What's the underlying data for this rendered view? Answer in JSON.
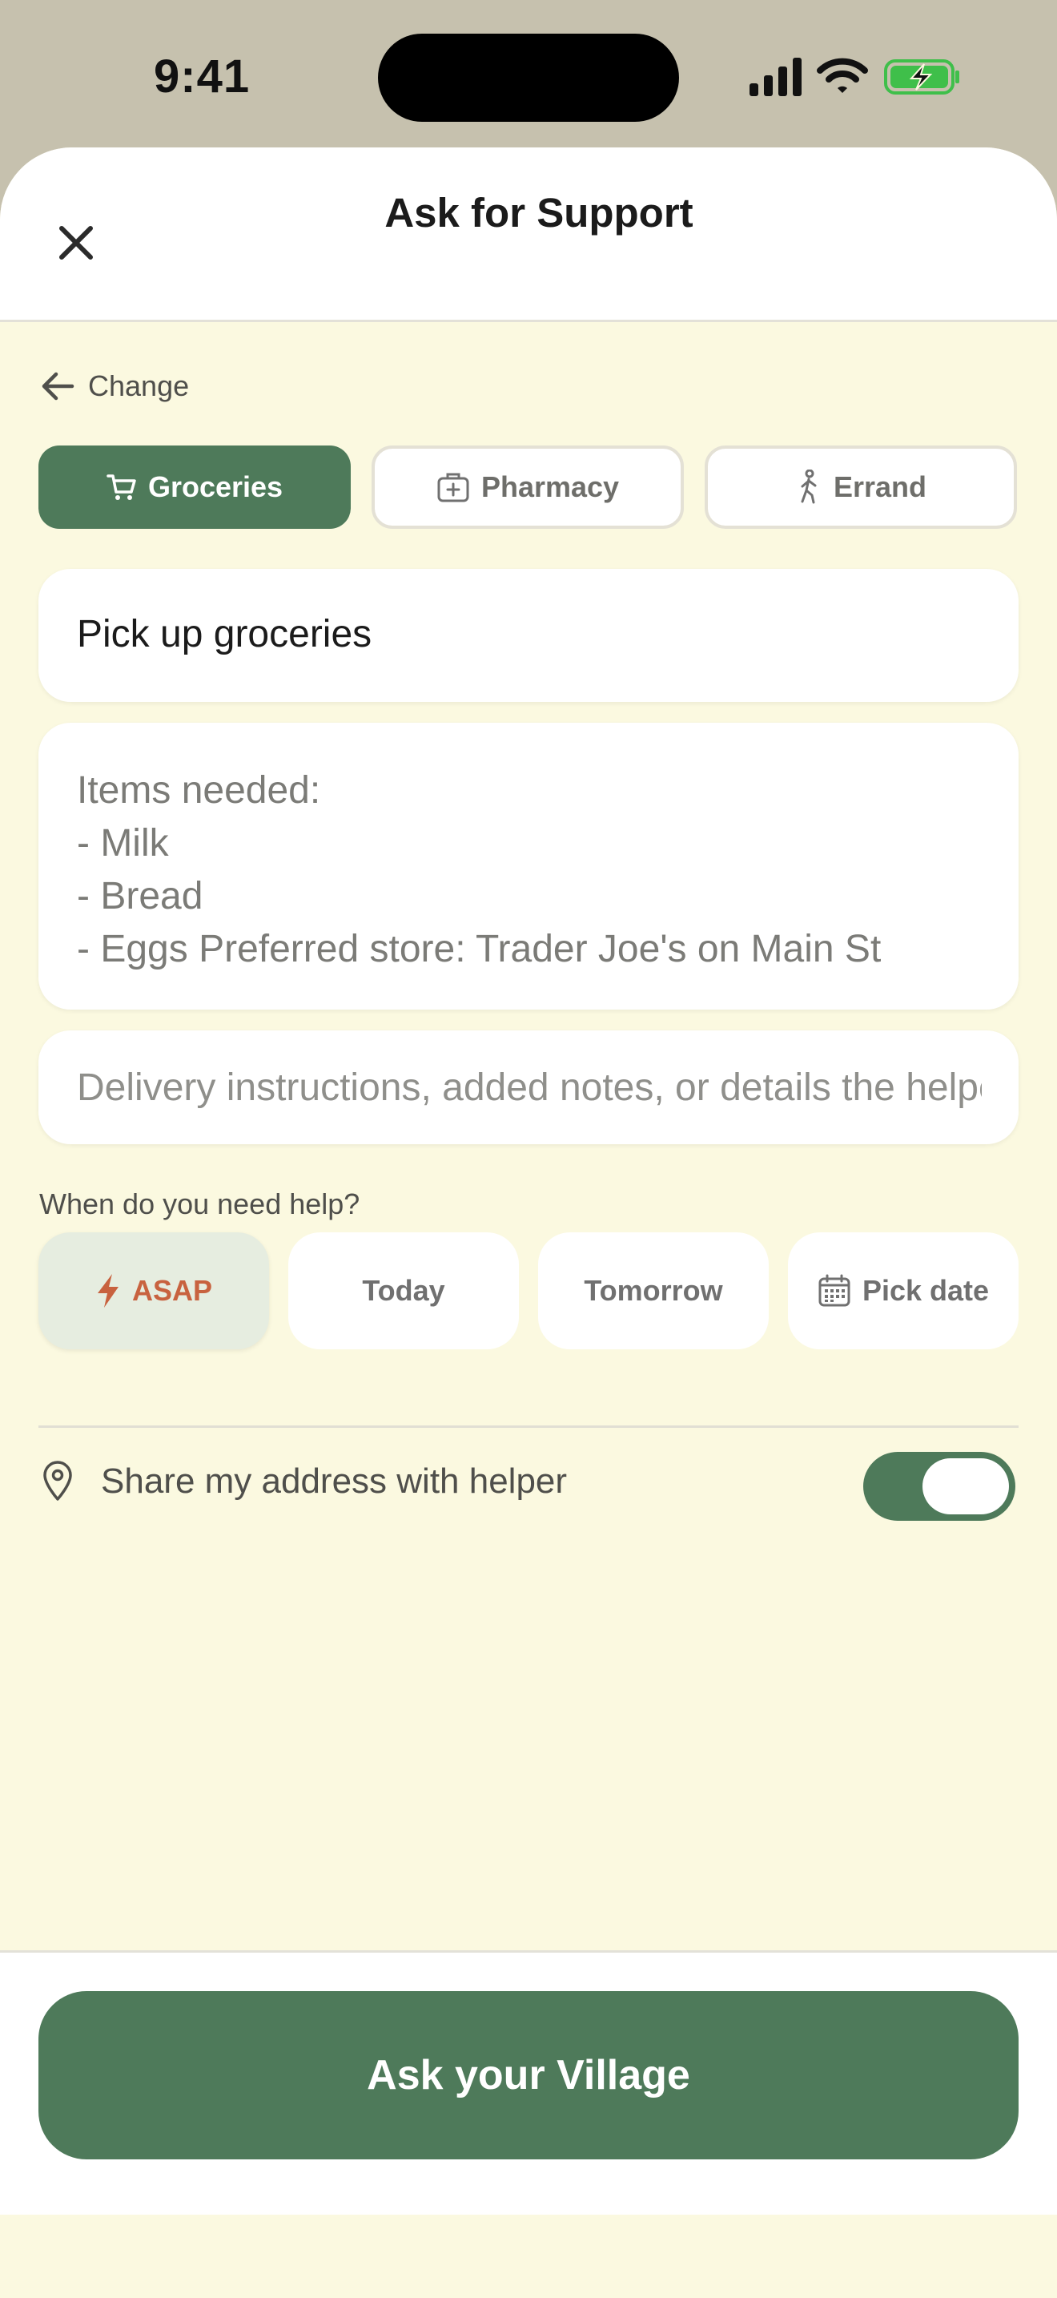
{
  "status_bar": {
    "time": "9:41"
  },
  "header": {
    "title": "Ask for Support",
    "close_icon": "close-icon"
  },
  "change_link": {
    "label": "Change",
    "icon": "arrow-left-icon"
  },
  "categories": [
    {
      "label": "Groceries",
      "icon": "cart-icon",
      "selected": true
    },
    {
      "label": "Pharmacy",
      "icon": "medical-kit-icon",
      "selected": false
    },
    {
      "label": "Errand",
      "icon": "walking-person-icon",
      "selected": false
    }
  ],
  "form": {
    "title_value": "Pick up groceries",
    "description_lines": [
      "Items needed:",
      "- Milk",
      "- Bread",
      "- Eggs Preferred store: Trader Joe's on Main St"
    ],
    "notes_placeholder": "Delivery instructions, added notes, or details the helper should know"
  },
  "when": {
    "label": "When do you need help?",
    "options": [
      {
        "label": "ASAP",
        "icon": "lightning-icon",
        "selected": true
      },
      {
        "label": "Today",
        "selected": false
      },
      {
        "label": "Tomorrow",
        "selected": false
      },
      {
        "label": "Pick date",
        "icon": "calendar-icon",
        "selected": false
      }
    ]
  },
  "share_address": {
    "label": "Share my address with helper",
    "enabled": true,
    "icon": "location-pin-icon"
  },
  "cta": {
    "label": "Ask your Village"
  },
  "colors": {
    "accent": "#4e7a5a",
    "background": "#fbf9e0",
    "asap": "#c8623f",
    "battery": "#3fbf4a"
  }
}
